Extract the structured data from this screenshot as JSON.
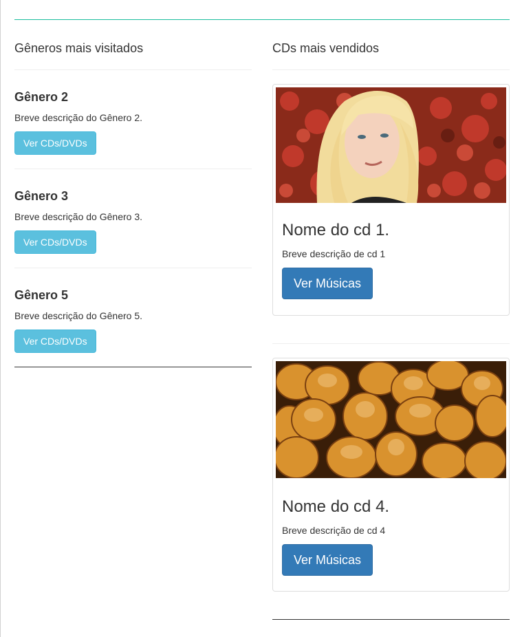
{
  "left": {
    "title": "Gêneros mais visitados",
    "genres": [
      {
        "name": "Gênero 2",
        "description": "Breve descrição do Gênero 2.",
        "button": "Ver CDs/DVDs"
      },
      {
        "name": "Gênero 3",
        "description": "Breve descrição do Gênero 3.",
        "button": "Ver CDs/DVDs"
      },
      {
        "name": "Gênero 5",
        "description": "Breve descrição do Gênero 5.",
        "button": "Ver CDs/DVDs"
      }
    ]
  },
  "right": {
    "title": "CDs mais vendidos",
    "cds": [
      {
        "name": "Nome do cd 1.",
        "description": "Breve descrição de cd 1",
        "button": "Ver Músicas",
        "image": "blonde-woman-photo"
      },
      {
        "name": "Nome do cd 4.",
        "description": "Breve descrição de cd 4",
        "button": "Ver Músicas",
        "image": "bread-rolls-photo"
      }
    ]
  },
  "colors": {
    "accent_rule": "#1abc9c",
    "info_button": "#5bc0de",
    "primary_button": "#337ab7"
  }
}
